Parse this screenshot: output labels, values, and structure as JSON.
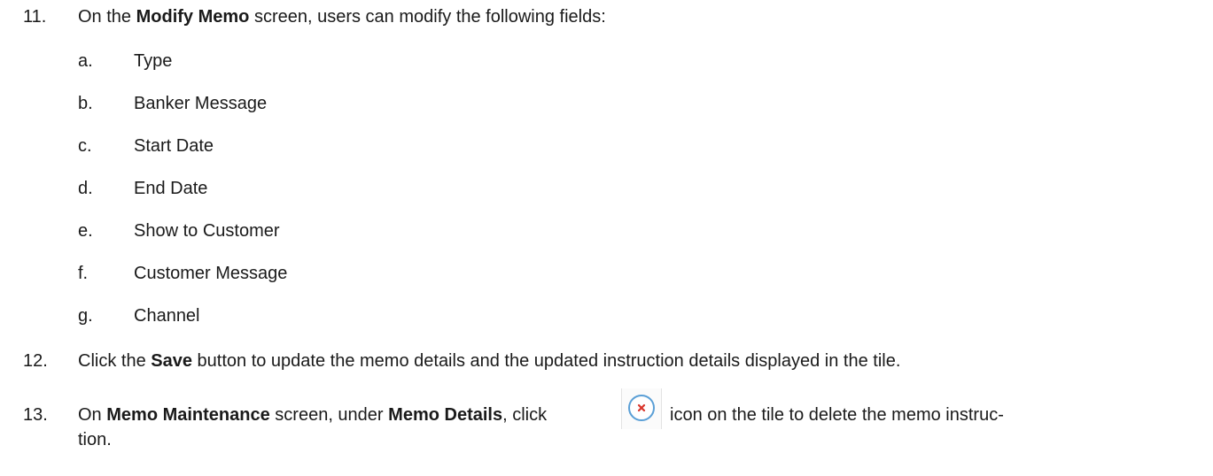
{
  "steps": [
    {
      "number": "11.",
      "pre": "On the ",
      "bold1": "Modify Memo",
      "post": " screen, users can modify the following fields:"
    },
    {
      "number": "12.",
      "pre": "Click the ",
      "bold1": "Save",
      "post": " button to update the memo details and the updated instruction details displayed in the tile."
    },
    {
      "number": "13.",
      "pre": "On ",
      "bold1": "Memo Maintenance",
      "mid": " screen, under ",
      "bold2": "Memo Details",
      "mid2": ", click ",
      "icon": "close-circle-icon",
      "post": " icon on the tile to delete the memo instruc-",
      "wrap": "tion."
    }
  ],
  "fields": [
    {
      "letter": "a.",
      "label": "Type"
    },
    {
      "letter": "b.",
      "label": "Banker Message"
    },
    {
      "letter": "c.",
      "label": "Start Date"
    },
    {
      "letter": "d.",
      "label": "End Date"
    },
    {
      "letter": "e.",
      "label": "Show to Customer"
    },
    {
      "letter": "f.",
      "label": "Customer Message"
    },
    {
      "letter": "g.",
      "label": "Channel"
    }
  ],
  "colors": {
    "text": "#1a1a1a",
    "icon_ring": "#5a9fd6",
    "icon_x": "#d9352b"
  }
}
